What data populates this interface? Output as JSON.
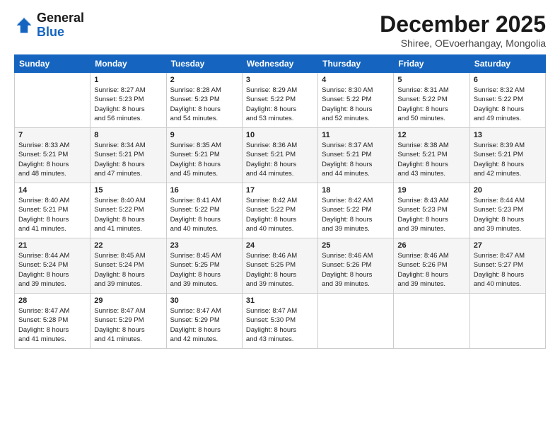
{
  "logo": {
    "line1": "General",
    "line2": "Blue"
  },
  "title": "December 2025",
  "location": "Shiree, OEvoerhangay, Mongolia",
  "headers": [
    "Sunday",
    "Monday",
    "Tuesday",
    "Wednesday",
    "Thursday",
    "Friday",
    "Saturday"
  ],
  "weeks": [
    [
      {
        "day": "",
        "info": ""
      },
      {
        "day": "1",
        "info": "Sunrise: 8:27 AM\nSunset: 5:23 PM\nDaylight: 8 hours\nand 56 minutes."
      },
      {
        "day": "2",
        "info": "Sunrise: 8:28 AM\nSunset: 5:23 PM\nDaylight: 8 hours\nand 54 minutes."
      },
      {
        "day": "3",
        "info": "Sunrise: 8:29 AM\nSunset: 5:22 PM\nDaylight: 8 hours\nand 53 minutes."
      },
      {
        "day": "4",
        "info": "Sunrise: 8:30 AM\nSunset: 5:22 PM\nDaylight: 8 hours\nand 52 minutes."
      },
      {
        "day": "5",
        "info": "Sunrise: 8:31 AM\nSunset: 5:22 PM\nDaylight: 8 hours\nand 50 minutes."
      },
      {
        "day": "6",
        "info": "Sunrise: 8:32 AM\nSunset: 5:22 PM\nDaylight: 8 hours\nand 49 minutes."
      }
    ],
    [
      {
        "day": "7",
        "info": "Sunrise: 8:33 AM\nSunset: 5:21 PM\nDaylight: 8 hours\nand 48 minutes."
      },
      {
        "day": "8",
        "info": "Sunrise: 8:34 AM\nSunset: 5:21 PM\nDaylight: 8 hours\nand 47 minutes."
      },
      {
        "day": "9",
        "info": "Sunrise: 8:35 AM\nSunset: 5:21 PM\nDaylight: 8 hours\nand 45 minutes."
      },
      {
        "day": "10",
        "info": "Sunrise: 8:36 AM\nSunset: 5:21 PM\nDaylight: 8 hours\nand 44 minutes."
      },
      {
        "day": "11",
        "info": "Sunrise: 8:37 AM\nSunset: 5:21 PM\nDaylight: 8 hours\nand 44 minutes."
      },
      {
        "day": "12",
        "info": "Sunrise: 8:38 AM\nSunset: 5:21 PM\nDaylight: 8 hours\nand 43 minutes."
      },
      {
        "day": "13",
        "info": "Sunrise: 8:39 AM\nSunset: 5:21 PM\nDaylight: 8 hours\nand 42 minutes."
      }
    ],
    [
      {
        "day": "14",
        "info": "Sunrise: 8:40 AM\nSunset: 5:21 PM\nDaylight: 8 hours\nand 41 minutes."
      },
      {
        "day": "15",
        "info": "Sunrise: 8:40 AM\nSunset: 5:22 PM\nDaylight: 8 hours\nand 41 minutes."
      },
      {
        "day": "16",
        "info": "Sunrise: 8:41 AM\nSunset: 5:22 PM\nDaylight: 8 hours\nand 40 minutes."
      },
      {
        "day": "17",
        "info": "Sunrise: 8:42 AM\nSunset: 5:22 PM\nDaylight: 8 hours\nand 40 minutes."
      },
      {
        "day": "18",
        "info": "Sunrise: 8:42 AM\nSunset: 5:22 PM\nDaylight: 8 hours\nand 39 minutes."
      },
      {
        "day": "19",
        "info": "Sunrise: 8:43 AM\nSunset: 5:23 PM\nDaylight: 8 hours\nand 39 minutes."
      },
      {
        "day": "20",
        "info": "Sunrise: 8:44 AM\nSunset: 5:23 PM\nDaylight: 8 hours\nand 39 minutes."
      }
    ],
    [
      {
        "day": "21",
        "info": "Sunrise: 8:44 AM\nSunset: 5:24 PM\nDaylight: 8 hours\nand 39 minutes."
      },
      {
        "day": "22",
        "info": "Sunrise: 8:45 AM\nSunset: 5:24 PM\nDaylight: 8 hours\nand 39 minutes."
      },
      {
        "day": "23",
        "info": "Sunrise: 8:45 AM\nSunset: 5:25 PM\nDaylight: 8 hours\nand 39 minutes."
      },
      {
        "day": "24",
        "info": "Sunrise: 8:46 AM\nSunset: 5:25 PM\nDaylight: 8 hours\nand 39 minutes."
      },
      {
        "day": "25",
        "info": "Sunrise: 8:46 AM\nSunset: 5:26 PM\nDaylight: 8 hours\nand 39 minutes."
      },
      {
        "day": "26",
        "info": "Sunrise: 8:46 AM\nSunset: 5:26 PM\nDaylight: 8 hours\nand 39 minutes."
      },
      {
        "day": "27",
        "info": "Sunrise: 8:47 AM\nSunset: 5:27 PM\nDaylight: 8 hours\nand 40 minutes."
      }
    ],
    [
      {
        "day": "28",
        "info": "Sunrise: 8:47 AM\nSunset: 5:28 PM\nDaylight: 8 hours\nand 41 minutes."
      },
      {
        "day": "29",
        "info": "Sunrise: 8:47 AM\nSunset: 5:29 PM\nDaylight: 8 hours\nand 41 minutes."
      },
      {
        "day": "30",
        "info": "Sunrise: 8:47 AM\nSunset: 5:29 PM\nDaylight: 8 hours\nand 42 minutes."
      },
      {
        "day": "31",
        "info": "Sunrise: 8:47 AM\nSunset: 5:30 PM\nDaylight: 8 hours\nand 43 minutes."
      },
      {
        "day": "",
        "info": ""
      },
      {
        "day": "",
        "info": ""
      },
      {
        "day": "",
        "info": ""
      }
    ]
  ]
}
